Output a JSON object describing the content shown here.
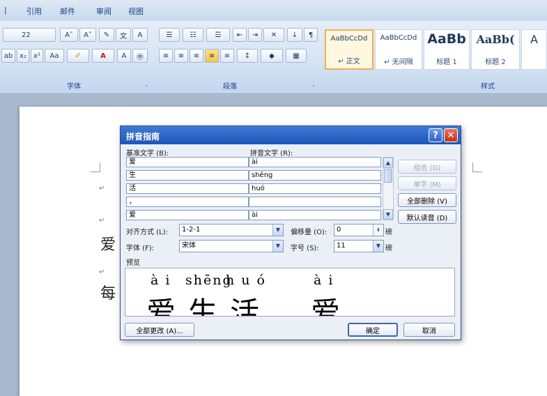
{
  "menu": {
    "tabs": [
      "引用",
      "邮件",
      "审阅",
      "视图"
    ]
  },
  "ribbon": {
    "font_size": "22",
    "font_group_label": "字体",
    "paragraph_group_label": "段落",
    "styles_group_label": "样式",
    "styles": [
      {
        "sample": "AaBbCcDd",
        "name": "正文",
        "selected": true
      },
      {
        "sample": "AaBbCcDd",
        "name": "无间隔",
        "selected": false
      },
      {
        "sample": "AaBb",
        "name": "标题 1",
        "selected": false
      },
      {
        "sample": "AaBb(",
        "name": "标题 2",
        "selected": false
      }
    ]
  },
  "document": {
    "visible_chars": [
      "爱",
      "每"
    ]
  },
  "dialog": {
    "title": "拼音指南",
    "base_text_label": "基准文字 (B):",
    "ruby_text_label": "拼音文字 (R):",
    "rows": [
      {
        "base": "爱",
        "ruby": "ài"
      },
      {
        "base": "生",
        "ruby": "shēng"
      },
      {
        "base": "活",
        "ruby": "huó"
      },
      {
        "base": "，",
        "ruby": ""
      },
      {
        "base": "爱",
        "ruby": "ài"
      }
    ],
    "buttons": {
      "combine": "组合 (G)",
      "single": "单字 (M)",
      "clear_all": "全部删除 (V)",
      "default_reading": "默认读音 (D)",
      "change_all": "全部更改 (A)...",
      "ok": "确定",
      "cancel": "取消"
    },
    "alignment_label": "对齐方式 (L):",
    "alignment_value": "1-2-1",
    "offset_label": "偏移量 (O):",
    "offset_value": "0",
    "offset_unit": "磅",
    "font_label": "字体 (F):",
    "font_value": "宋体",
    "size_label": "字号 (S):",
    "size_value": "11",
    "size_unit": "磅",
    "preview_label": "预览",
    "preview": {
      "pinyin": [
        "à i",
        "shēng",
        "h u ó",
        "à i"
      ],
      "hanzi": [
        "爱",
        "生",
        "活",
        "，",
        "爱"
      ]
    }
  }
}
